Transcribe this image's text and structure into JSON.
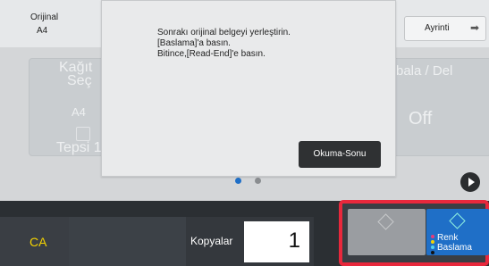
{
  "topbar": {
    "original_label": "Orijinal",
    "original_size": "A4",
    "detail_label": "Ayrinti"
  },
  "background": {
    "paper_select_line1": "Kağıt",
    "paper_select_line2": "Seç",
    "paper_size": "A4",
    "tray": "Tepsi 1",
    "right_label": "bala / Del",
    "right_value": "Off"
  },
  "dialog": {
    "line1": "Sonrakı orijinal belgeyi yerleştirin.",
    "line2": "[Baslama]'a basın.",
    "line3": "Bitince,[Read-End]'e basın.",
    "button_label": "Okuma-Sonu"
  },
  "bottom": {
    "ca_label": "CA",
    "copies_label": "Kopyalar",
    "copies_value": "1",
    "color_start_line1": "Renk",
    "color_start_line2": "Baslama"
  },
  "colors": {
    "accent_yellow": "#f6d400",
    "highlight_red": "#e8283c",
    "start_blue": "#1f6fc7",
    "page_dot_active": "#1f6fc7",
    "page_dot_inactive": "#8a8d90"
  }
}
